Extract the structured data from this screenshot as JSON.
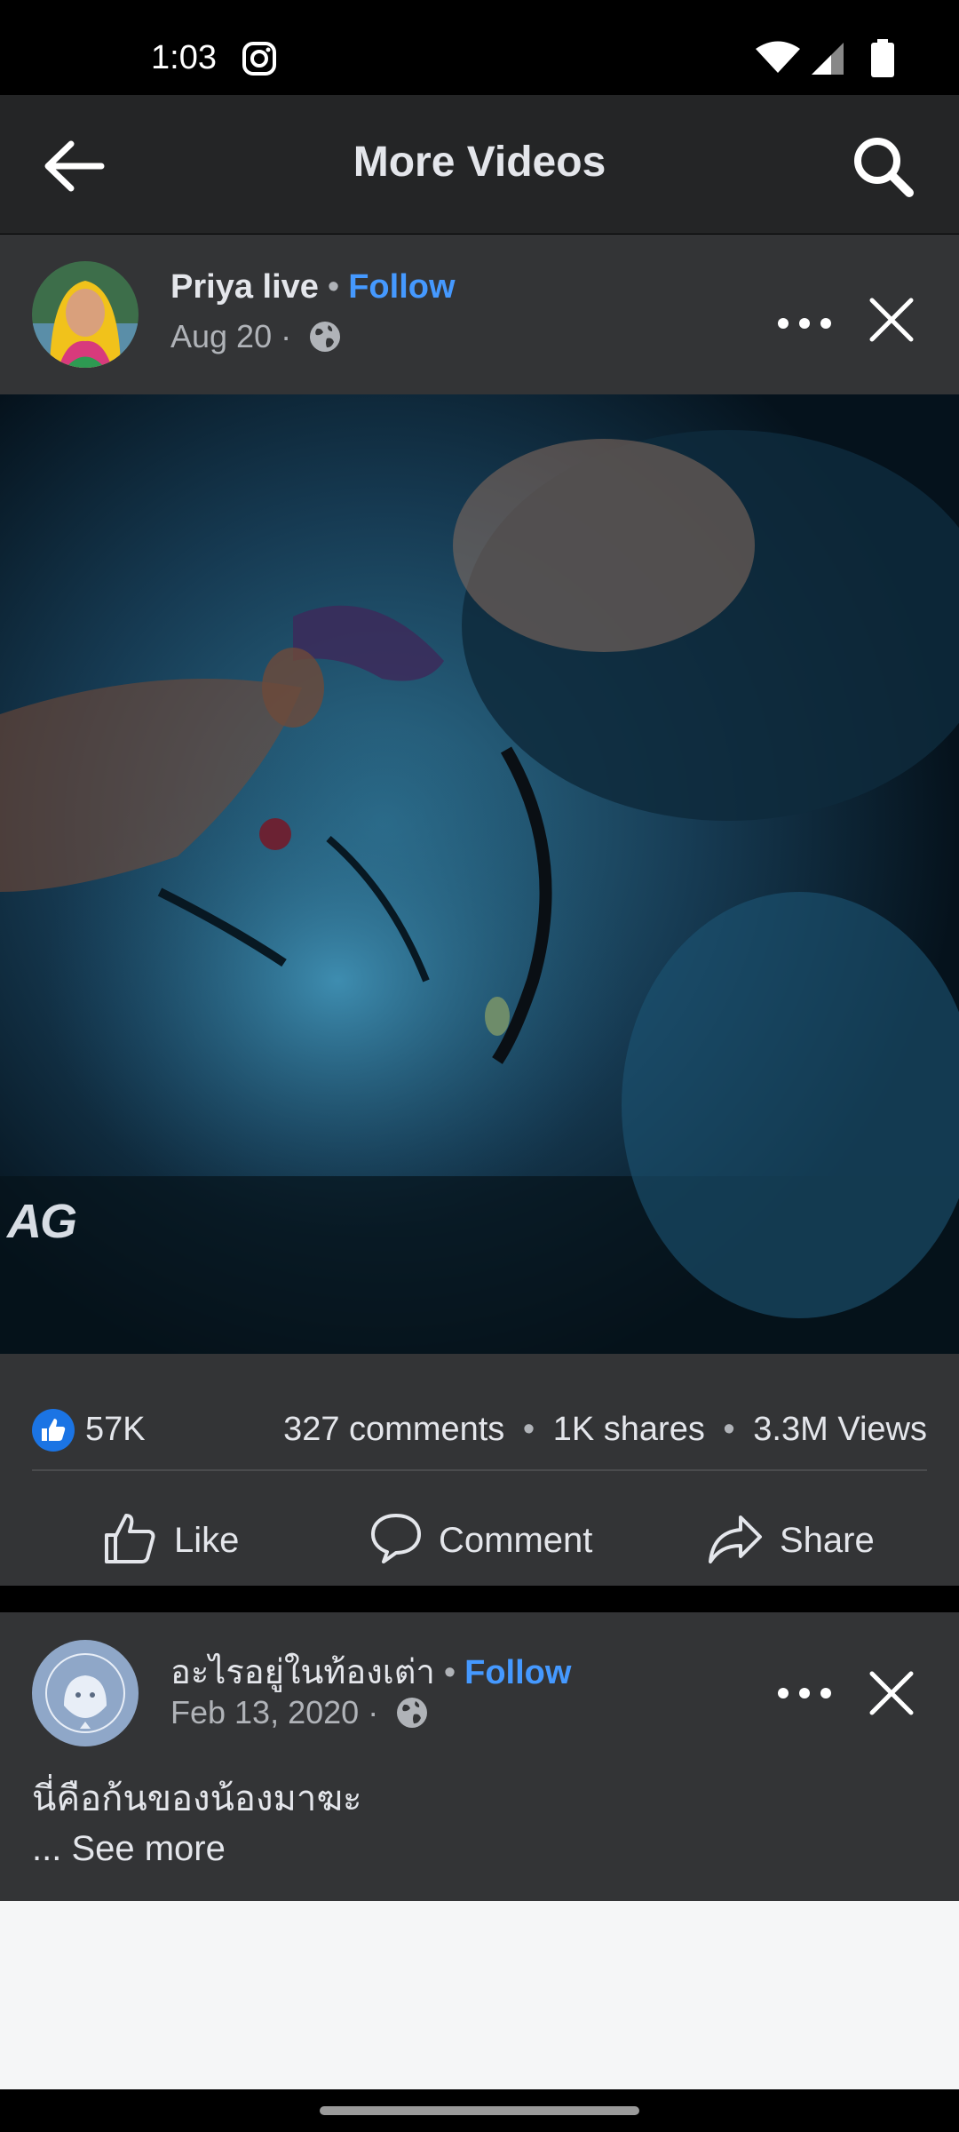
{
  "status_bar": {
    "time": "1:03"
  },
  "app_bar": {
    "title": "More Videos"
  },
  "post1": {
    "author": "Priya live",
    "separator": "•",
    "follow_label": "Follow",
    "date": "Aug 20",
    "meta_separator": "·",
    "video_watermark": "AG",
    "likes": "57K",
    "comments": "327 comments",
    "shares": "1K shares",
    "views": "3.3M Views",
    "actions": {
      "like": "Like",
      "comment": "Comment",
      "share": "Share"
    }
  },
  "post2": {
    "author": "อะไรอยู่ในท้องเต่า",
    "separator": "•",
    "follow_label": "Follow",
    "date": "Feb 13, 2020",
    "meta_separator": "·",
    "text": "นี่คือก้นของน้องมาฆะ",
    "see_more": "... See more"
  },
  "colors": {
    "app_bar_bg": "#242526",
    "card_bg": "#333436",
    "accent_blue": "#4599ff",
    "like_blue": "#1b74e4",
    "text_primary": "#e4e6eb",
    "text_secondary": "#b0b3b8"
  },
  "icons": {
    "status": [
      "instagram-icon",
      "wifi-icon",
      "signal-icon",
      "battery-icon"
    ],
    "app_bar": [
      "back-arrow-icon",
      "search-icon"
    ],
    "post": [
      "globe-icon",
      "more-dots-icon",
      "close-icon",
      "like-reaction-icon",
      "thumb-up-icon",
      "comment-icon",
      "share-icon"
    ]
  }
}
